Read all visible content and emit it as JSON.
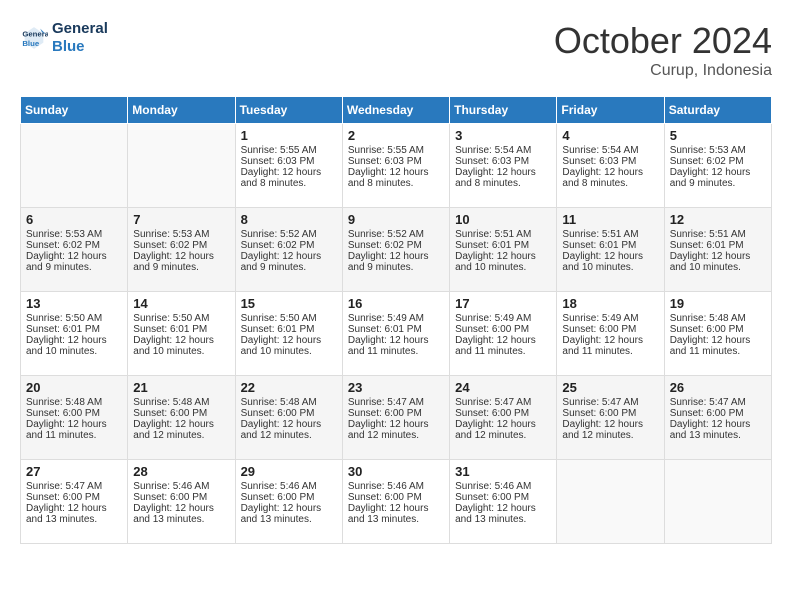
{
  "header": {
    "logo_line1": "General",
    "logo_line2": "Blue",
    "month": "October 2024",
    "location": "Curup, Indonesia"
  },
  "weekdays": [
    "Sunday",
    "Monday",
    "Tuesday",
    "Wednesday",
    "Thursday",
    "Friday",
    "Saturday"
  ],
  "weeks": [
    [
      {
        "day": "",
        "sunrise": "",
        "sunset": "",
        "daylight": ""
      },
      {
        "day": "",
        "sunrise": "",
        "sunset": "",
        "daylight": ""
      },
      {
        "day": "1",
        "sunrise": "Sunrise: 5:55 AM",
        "sunset": "Sunset: 6:03 PM",
        "daylight": "Daylight: 12 hours and 8 minutes."
      },
      {
        "day": "2",
        "sunrise": "Sunrise: 5:55 AM",
        "sunset": "Sunset: 6:03 PM",
        "daylight": "Daylight: 12 hours and 8 minutes."
      },
      {
        "day": "3",
        "sunrise": "Sunrise: 5:54 AM",
        "sunset": "Sunset: 6:03 PM",
        "daylight": "Daylight: 12 hours and 8 minutes."
      },
      {
        "day": "4",
        "sunrise": "Sunrise: 5:54 AM",
        "sunset": "Sunset: 6:03 PM",
        "daylight": "Daylight: 12 hours and 8 minutes."
      },
      {
        "day": "5",
        "sunrise": "Sunrise: 5:53 AM",
        "sunset": "Sunset: 6:02 PM",
        "daylight": "Daylight: 12 hours and 9 minutes."
      }
    ],
    [
      {
        "day": "6",
        "sunrise": "Sunrise: 5:53 AM",
        "sunset": "Sunset: 6:02 PM",
        "daylight": "Daylight: 12 hours and 9 minutes."
      },
      {
        "day": "7",
        "sunrise": "Sunrise: 5:53 AM",
        "sunset": "Sunset: 6:02 PM",
        "daylight": "Daylight: 12 hours and 9 minutes."
      },
      {
        "day": "8",
        "sunrise": "Sunrise: 5:52 AM",
        "sunset": "Sunset: 6:02 PM",
        "daylight": "Daylight: 12 hours and 9 minutes."
      },
      {
        "day": "9",
        "sunrise": "Sunrise: 5:52 AM",
        "sunset": "Sunset: 6:02 PM",
        "daylight": "Daylight: 12 hours and 9 minutes."
      },
      {
        "day": "10",
        "sunrise": "Sunrise: 5:51 AM",
        "sunset": "Sunset: 6:01 PM",
        "daylight": "Daylight: 12 hours and 10 minutes."
      },
      {
        "day": "11",
        "sunrise": "Sunrise: 5:51 AM",
        "sunset": "Sunset: 6:01 PM",
        "daylight": "Daylight: 12 hours and 10 minutes."
      },
      {
        "day": "12",
        "sunrise": "Sunrise: 5:51 AM",
        "sunset": "Sunset: 6:01 PM",
        "daylight": "Daylight: 12 hours and 10 minutes."
      }
    ],
    [
      {
        "day": "13",
        "sunrise": "Sunrise: 5:50 AM",
        "sunset": "Sunset: 6:01 PM",
        "daylight": "Daylight: 12 hours and 10 minutes."
      },
      {
        "day": "14",
        "sunrise": "Sunrise: 5:50 AM",
        "sunset": "Sunset: 6:01 PM",
        "daylight": "Daylight: 12 hours and 10 minutes."
      },
      {
        "day": "15",
        "sunrise": "Sunrise: 5:50 AM",
        "sunset": "Sunset: 6:01 PM",
        "daylight": "Daylight: 12 hours and 10 minutes."
      },
      {
        "day": "16",
        "sunrise": "Sunrise: 5:49 AM",
        "sunset": "Sunset: 6:01 PM",
        "daylight": "Daylight: 12 hours and 11 minutes."
      },
      {
        "day": "17",
        "sunrise": "Sunrise: 5:49 AM",
        "sunset": "Sunset: 6:00 PM",
        "daylight": "Daylight: 12 hours and 11 minutes."
      },
      {
        "day": "18",
        "sunrise": "Sunrise: 5:49 AM",
        "sunset": "Sunset: 6:00 PM",
        "daylight": "Daylight: 12 hours and 11 minutes."
      },
      {
        "day": "19",
        "sunrise": "Sunrise: 5:48 AM",
        "sunset": "Sunset: 6:00 PM",
        "daylight": "Daylight: 12 hours and 11 minutes."
      }
    ],
    [
      {
        "day": "20",
        "sunrise": "Sunrise: 5:48 AM",
        "sunset": "Sunset: 6:00 PM",
        "daylight": "Daylight: 12 hours and 11 minutes."
      },
      {
        "day": "21",
        "sunrise": "Sunrise: 5:48 AM",
        "sunset": "Sunset: 6:00 PM",
        "daylight": "Daylight: 12 hours and 12 minutes."
      },
      {
        "day": "22",
        "sunrise": "Sunrise: 5:48 AM",
        "sunset": "Sunset: 6:00 PM",
        "daylight": "Daylight: 12 hours and 12 minutes."
      },
      {
        "day": "23",
        "sunrise": "Sunrise: 5:47 AM",
        "sunset": "Sunset: 6:00 PM",
        "daylight": "Daylight: 12 hours and 12 minutes."
      },
      {
        "day": "24",
        "sunrise": "Sunrise: 5:47 AM",
        "sunset": "Sunset: 6:00 PM",
        "daylight": "Daylight: 12 hours and 12 minutes."
      },
      {
        "day": "25",
        "sunrise": "Sunrise: 5:47 AM",
        "sunset": "Sunset: 6:00 PM",
        "daylight": "Daylight: 12 hours and 12 minutes."
      },
      {
        "day": "26",
        "sunrise": "Sunrise: 5:47 AM",
        "sunset": "Sunset: 6:00 PM",
        "daylight": "Daylight: 12 hours and 13 minutes."
      }
    ],
    [
      {
        "day": "27",
        "sunrise": "Sunrise: 5:47 AM",
        "sunset": "Sunset: 6:00 PM",
        "daylight": "Daylight: 12 hours and 13 minutes."
      },
      {
        "day": "28",
        "sunrise": "Sunrise: 5:46 AM",
        "sunset": "Sunset: 6:00 PM",
        "daylight": "Daylight: 12 hours and 13 minutes."
      },
      {
        "day": "29",
        "sunrise": "Sunrise: 5:46 AM",
        "sunset": "Sunset: 6:00 PM",
        "daylight": "Daylight: 12 hours and 13 minutes."
      },
      {
        "day": "30",
        "sunrise": "Sunrise: 5:46 AM",
        "sunset": "Sunset: 6:00 PM",
        "daylight": "Daylight: 12 hours and 13 minutes."
      },
      {
        "day": "31",
        "sunrise": "Sunrise: 5:46 AM",
        "sunset": "Sunset: 6:00 PM",
        "daylight": "Daylight: 12 hours and 13 minutes."
      },
      {
        "day": "",
        "sunrise": "",
        "sunset": "",
        "daylight": ""
      },
      {
        "day": "",
        "sunrise": "",
        "sunset": "",
        "daylight": ""
      }
    ]
  ]
}
